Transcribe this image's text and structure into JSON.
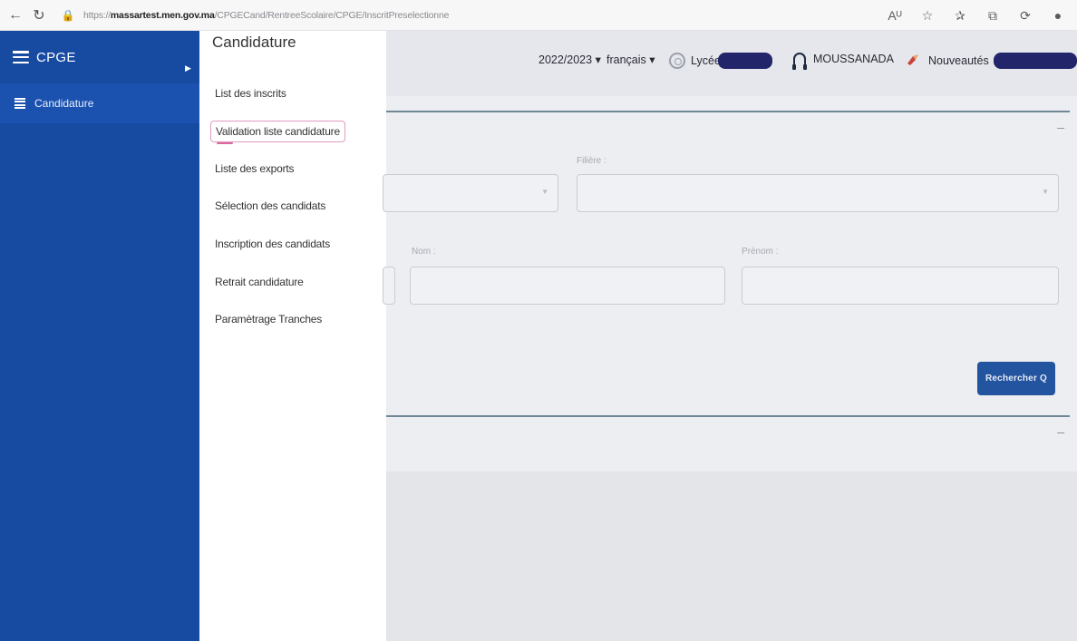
{
  "browser": {
    "url_prefix": "https://",
    "url_domain": "massartest.men.gov.ma",
    "url_path": "/CPGECand/RentreeScolaire/CPGE/InscritPreselectionne",
    "icons": [
      "read-aloud-icon",
      "favorite-icon",
      "favorites-list-icon",
      "collections-icon",
      "history-icon",
      "profile-icon"
    ]
  },
  "sidebar": {
    "title": "CPGE",
    "items": [
      {
        "label": "Candidature"
      }
    ]
  },
  "flyout": {
    "title": "Candidature",
    "items": [
      {
        "label": "List des inscrits"
      },
      {
        "label": "Validation liste candidature",
        "active": true
      },
      {
        "label": "Liste des exports"
      },
      {
        "label": "Sélection des candidats"
      },
      {
        "label": "Inscription des candidats"
      },
      {
        "label": "Retrait candidature"
      },
      {
        "label": "Paramètrage Tranches"
      }
    ]
  },
  "topbar": {
    "year": "2022/2023",
    "language": "français",
    "school_label": "Lycée",
    "support": "MOUSSANADA",
    "news": "Nouveautés"
  },
  "search_form": {
    "filiere_label": "Filière :",
    "nom_label": "Nom :",
    "prenom_label": "Prénom :",
    "search_button": "Rechercher Q"
  },
  "colors": {
    "sidebar": "#174aa1",
    "button": "#23549f",
    "active_outline": "#e29bc0"
  }
}
